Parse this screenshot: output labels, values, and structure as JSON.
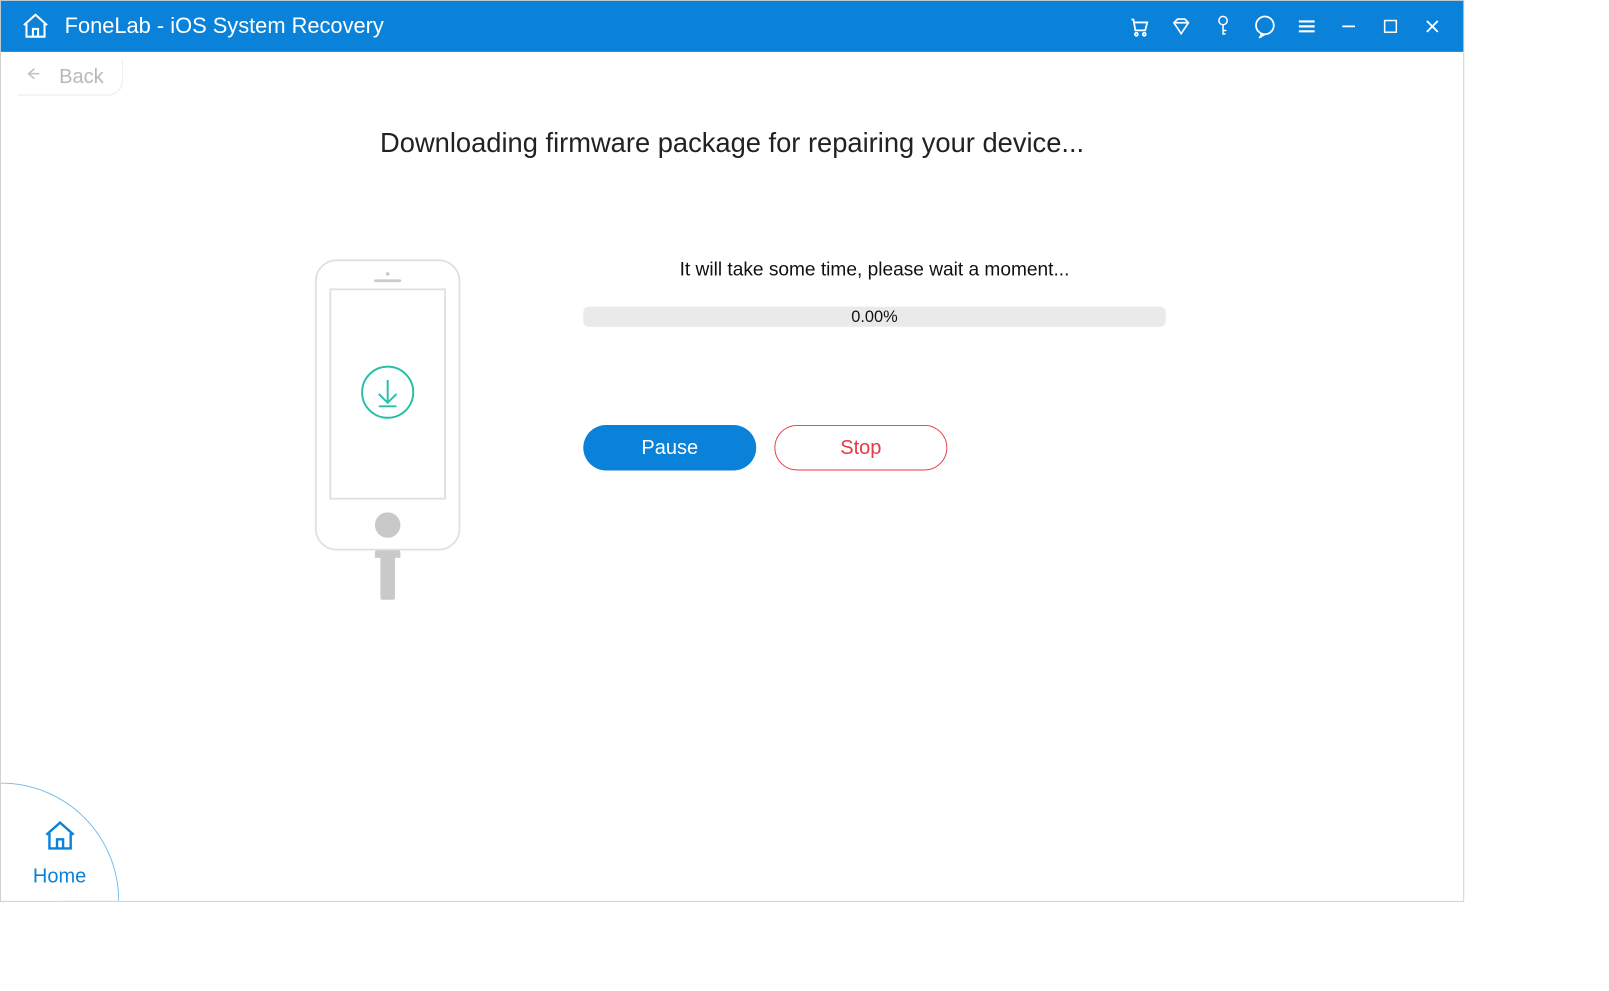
{
  "app": {
    "title": "FoneLab - iOS System Recovery"
  },
  "nav": {
    "back_label": "Back",
    "home_label": "Home"
  },
  "main": {
    "heading": "Downloading firmware package for repairing your device...",
    "wait_text": "It will take some time, please wait a moment...",
    "progress_percent": "0.00%"
  },
  "buttons": {
    "pause": "Pause",
    "stop": "Stop"
  },
  "colors": {
    "primary": "#0b82d9",
    "danger": "#e53946",
    "download_icon": "#26bfa6"
  }
}
